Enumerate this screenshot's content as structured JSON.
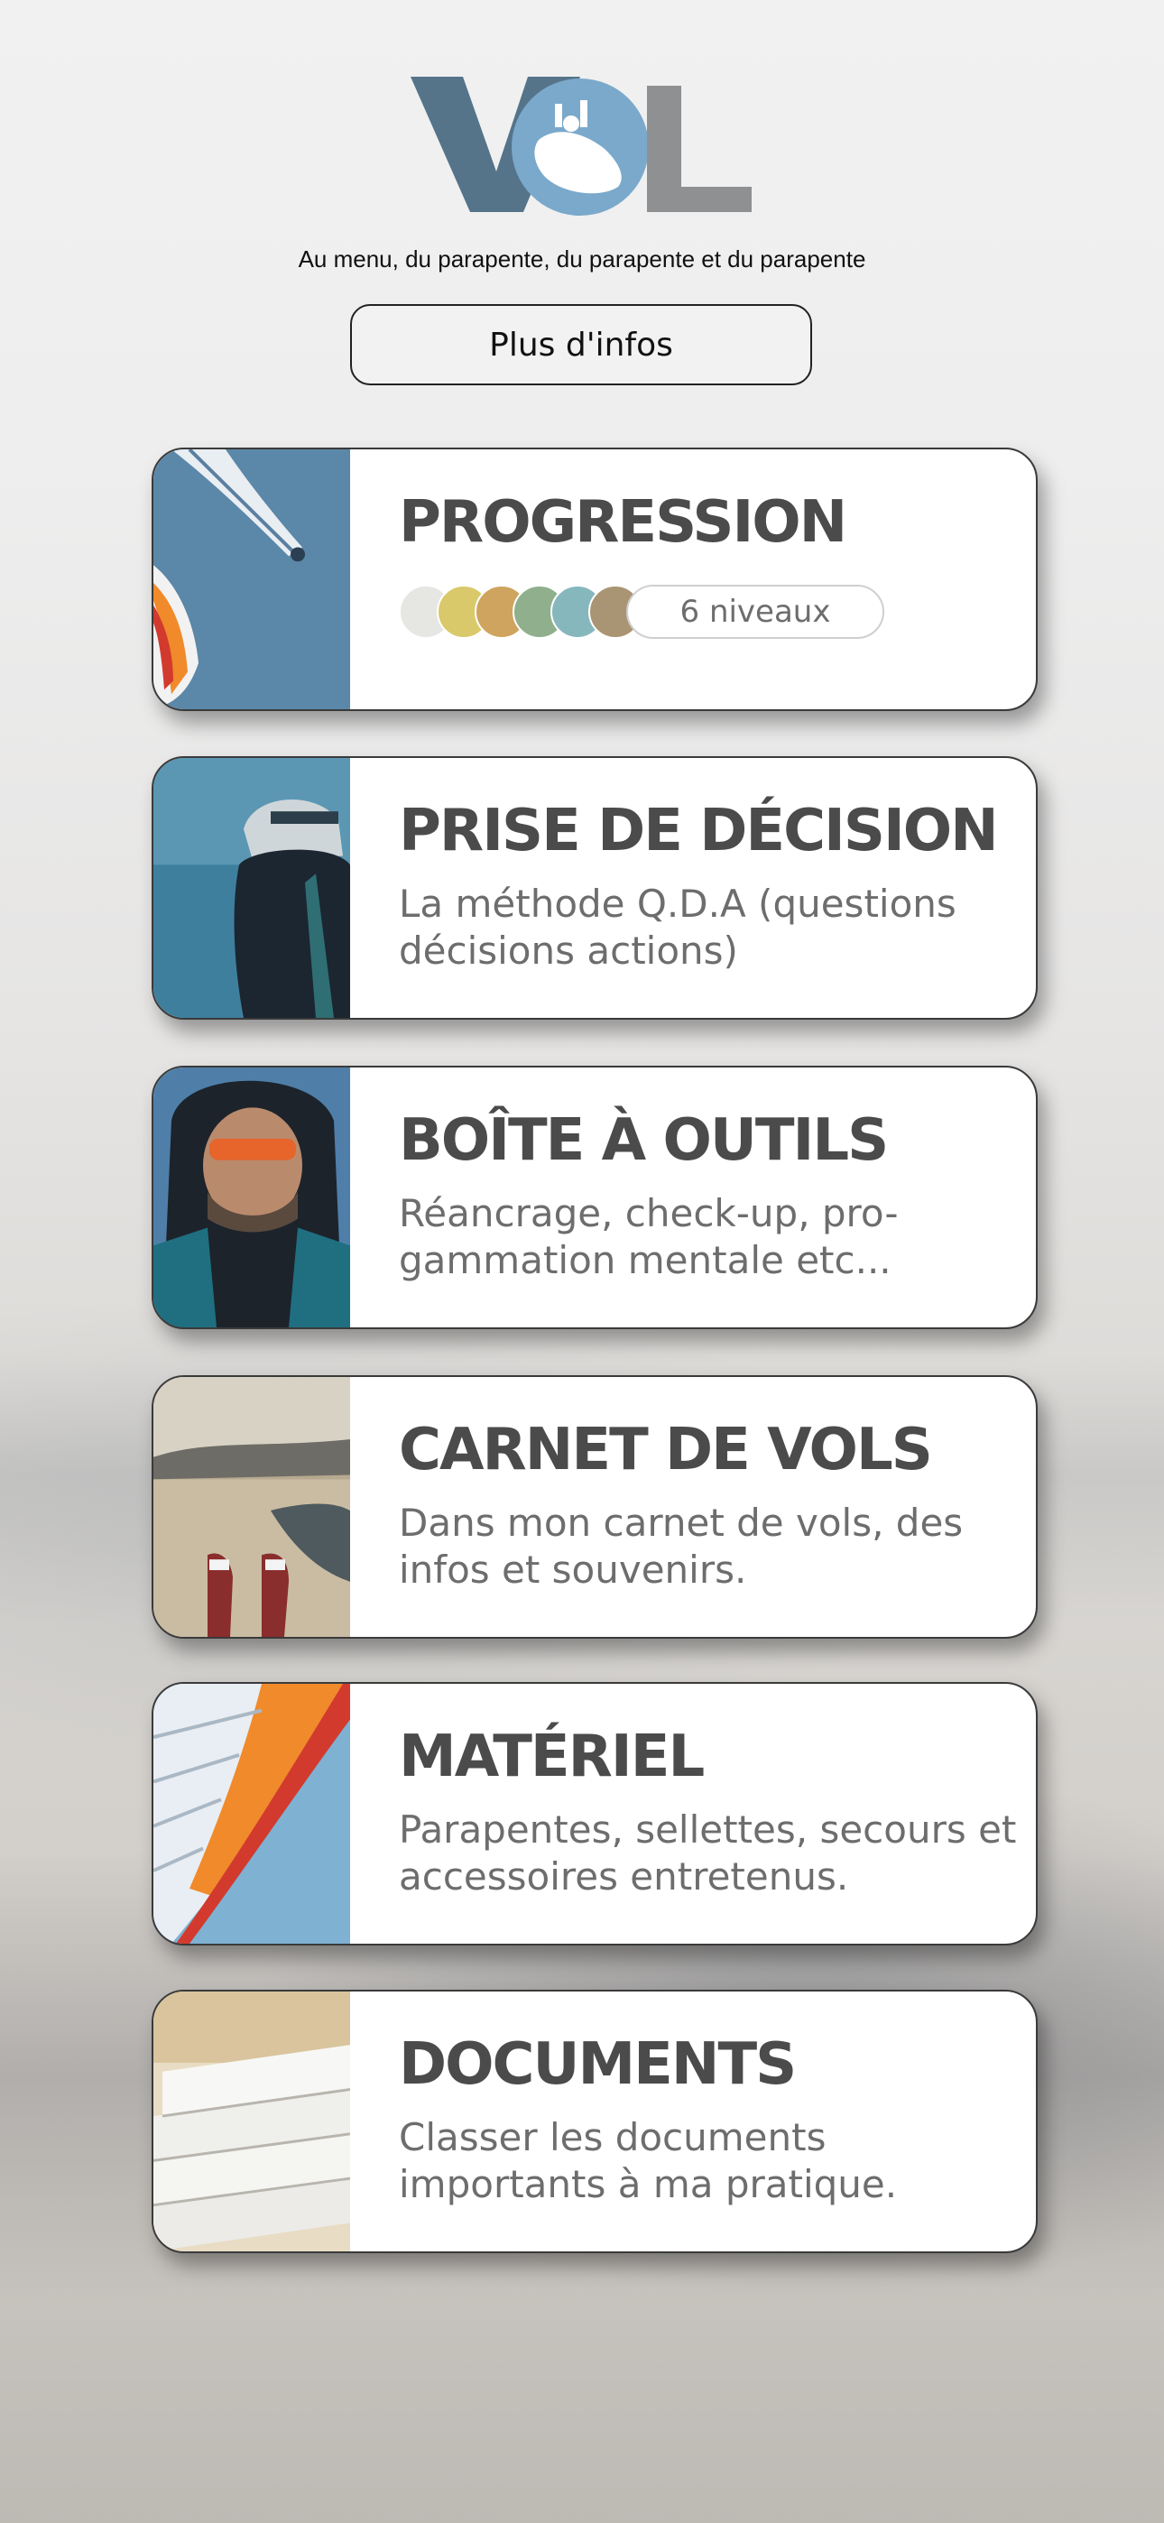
{
  "header": {
    "logo_letters": [
      "V",
      "O",
      "L"
    ],
    "logo_colors": {
      "v": "#55748a",
      "o": "#7aa9cb",
      "l": "#8e9092"
    },
    "tagline": "Au menu, du parapente, du parapente et du parapente",
    "info_button_label": "Plus d'infos"
  },
  "cards": [
    {
      "title": "PROGRESSION",
      "thumb_icon": "paraglider-sky-photo",
      "levels": {
        "count_label": "6 niveaux",
        "colors": [
          "#e6e6e3",
          "#d9c96a",
          "#cfa45e",
          "#8faf8d",
          "#86b7bd",
          "#a99574"
        ]
      }
    },
    {
      "title": "PRISE DE DÉCISION",
      "description": "La méthode Q.D.A (questions décisions actions)",
      "thumb_icon": "pilot-helmet-photo"
    },
    {
      "title": "BOÎTE À OUTILS",
      "description": "Réancrage, check-up, pro-gammation mentale etc...",
      "thumb_icon": "pilot-portrait-photo"
    },
    {
      "title": "CARNET DE VOLS",
      "description": "Dans mon carnet de vols, des infos et souvenirs.",
      "thumb_icon": "lake-feet-photo"
    },
    {
      "title": "MATÉRIEL",
      "description": "Parapentes, sellettes, secours et accessoires entretenus.",
      "thumb_icon": "wing-closeup-photo"
    },
    {
      "title": "DOCUMENTS",
      "description": "Classer les documents importants à ma pratique.",
      "thumb_icon": "paper-stack-photo"
    }
  ]
}
